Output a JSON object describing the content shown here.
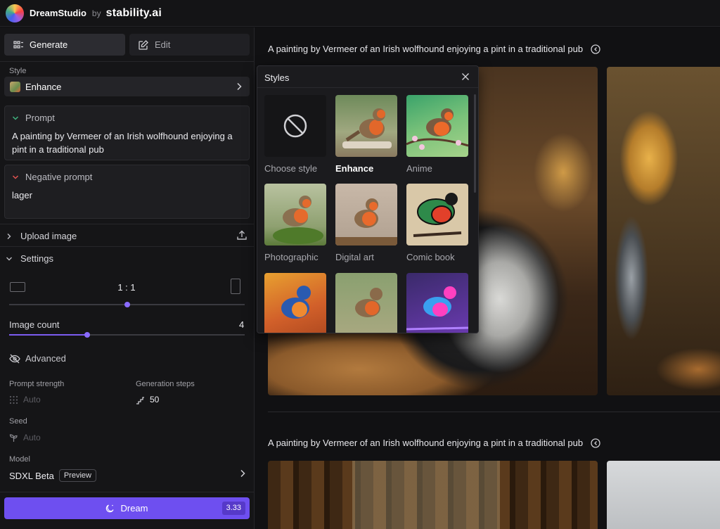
{
  "topbar": {
    "app_name": "DreamStudio",
    "by": "by",
    "company": "stability.ai"
  },
  "sidebar": {
    "modes": {
      "generate": "Generate",
      "edit": "Edit"
    },
    "style": {
      "label": "Style",
      "value": "Enhance"
    },
    "prompt": {
      "label": "Prompt",
      "text": "A painting by Vermeer of an Irish wolfhound enjoying a pint in a traditional pub"
    },
    "negative_prompt": {
      "label": "Negative prompt",
      "text": "lager"
    },
    "upload": {
      "label": "Upload image"
    },
    "settings": {
      "label": "Settings",
      "aspect_ratio": "1 : 1",
      "aspect_ratio_level": 0.5,
      "image_count_label": "Image count",
      "image_count": "4",
      "image_count_level": 0.33
    },
    "advanced": {
      "label": "Advanced",
      "prompt_strength_label": "Prompt strength",
      "prompt_strength_value": "Auto",
      "generation_steps_label": "Generation steps",
      "generation_steps_value": "50",
      "seed_label": "Seed",
      "seed_value": "Auto"
    },
    "model": {
      "label": "Model",
      "value": "SDXL Beta",
      "badge": "Preview"
    },
    "dream": {
      "label": "Dream",
      "cost": "3.33"
    }
  },
  "main": {
    "generations": [
      {
        "prompt": "A painting by Vermeer of an Irish wolfhound enjoying a pint in a traditional pub"
      },
      {
        "prompt": "A painting by Vermeer of an Irish wolfhound enjoying a pint in a traditional pub"
      }
    ]
  },
  "styles_popup": {
    "title": "Styles",
    "selected": "Enhance",
    "items": [
      {
        "label": "Choose style"
      },
      {
        "label": "Enhance"
      },
      {
        "label": "Anime"
      },
      {
        "label": "Photographic"
      },
      {
        "label": "Digital art"
      },
      {
        "label": "Comic book"
      }
    ]
  },
  "colors": {
    "accent": "#6e4ff0",
    "background": "#0f0f11",
    "panel": "#151517"
  }
}
